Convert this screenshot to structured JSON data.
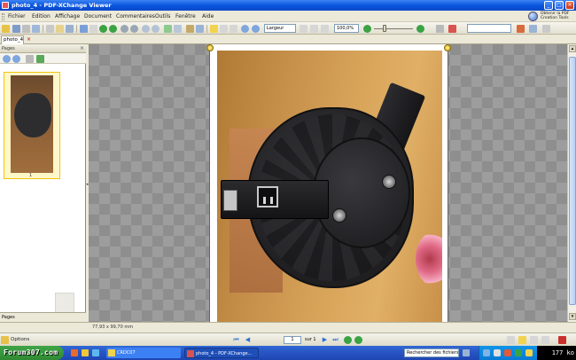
{
  "window": {
    "title": "photo_4 - PDF-XChange Viewer",
    "minimize_label": "_",
    "maximize_label": "□",
    "close_label": "×"
  },
  "menubar": {
    "items": [
      "Fichier",
      "Edition",
      "Affichage",
      "Document",
      "Commentaires",
      "Outils",
      "Fenêtre",
      "Aide"
    ]
  },
  "promo": {
    "line1": "Obtenir la PDF",
    "line2": "Creation Tools"
  },
  "toolbar": {
    "zoom_mode": "Largeur",
    "zoom_level": "100,0%",
    "search_value": ""
  },
  "tabs": {
    "document_tab": "photo_4",
    "close_label": "×"
  },
  "sidepanel": {
    "title": "Pages",
    "close_label": "×",
    "thumbnail_page": "1",
    "bottom_tab": "Pages"
  },
  "statusbar": {
    "page_size": "77,93 x 99,70 mm"
  },
  "navbar": {
    "options_label": "Options",
    "page_current": "1",
    "page_total": "sur 1"
  },
  "taskbar": {
    "watermark": "Forum307.com",
    "tasks": [
      "CRDC07",
      "photo_4 - PDF-XChange..."
    ],
    "address_label": "Rechercher des fichiers",
    "clock": "",
    "file_size": "177 ko"
  },
  "colors": {
    "title_bar": "#0a56e0",
    "taskbar": "#2957c6",
    "selection": "#f1c40f"
  }
}
